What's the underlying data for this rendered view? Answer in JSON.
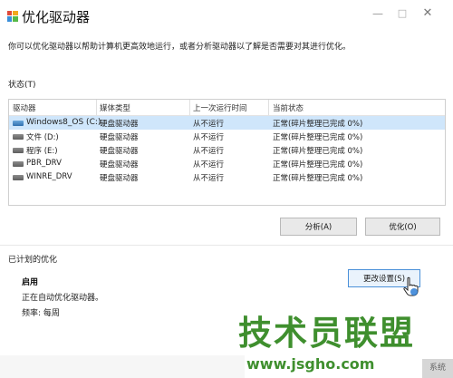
{
  "window": {
    "title": "优化驱动器",
    "min_glyph": "—",
    "max_glyph": "□",
    "close_glyph": "✕"
  },
  "description": "你可以优化驱动器以帮助计算机更高效地运行，或者分析驱动器以了解是否需要对其进行优化。",
  "status": {
    "label": "状态(T)",
    "columns": [
      "驱动器",
      "媒体类型",
      "上一次运行时间",
      "当前状态"
    ],
    "rows": [
      {
        "name": "Windows8_OS (C:)",
        "media": "硬盘驱动器",
        "last_run": "从不运行",
        "state": "正常(碎片整理已完成 0%)",
        "selected": true
      },
      {
        "name": "文件 (D:)",
        "media": "硬盘驱动器",
        "last_run": "从不运行",
        "state": "正常(碎片整理已完成 0%)",
        "selected": false
      },
      {
        "name": "程序 (E:)",
        "media": "硬盘驱动器",
        "last_run": "从不运行",
        "state": "正常(碎片整理已完成 0%)",
        "selected": false
      },
      {
        "name": "PBR_DRV",
        "media": "硬盘驱动器",
        "last_run": "从不运行",
        "state": "正常(碎片整理已完成 0%)",
        "selected": false
      },
      {
        "name": "WINRE_DRV",
        "media": "硬盘驱动器",
        "last_run": "从不运行",
        "state": "正常(碎片整理已完成 0%)",
        "selected": false
      }
    ]
  },
  "buttons": {
    "analyze": "分析(A)",
    "optimize": "优化(O)",
    "change_settings": "更改设置(S)"
  },
  "scheduled": {
    "label": "已计划的优化",
    "enabled": "启用",
    "desc": "正在自动优化驱动器。",
    "frequency": "频率: 每周"
  },
  "watermark": {
    "main": "技术员联盟",
    "url": "www.jsgho.com",
    "corner": "系统"
  },
  "colors": {
    "selection": "#cfe6fb",
    "watermark": "#3f8f2e",
    "focus_border": "#4a90d9"
  }
}
